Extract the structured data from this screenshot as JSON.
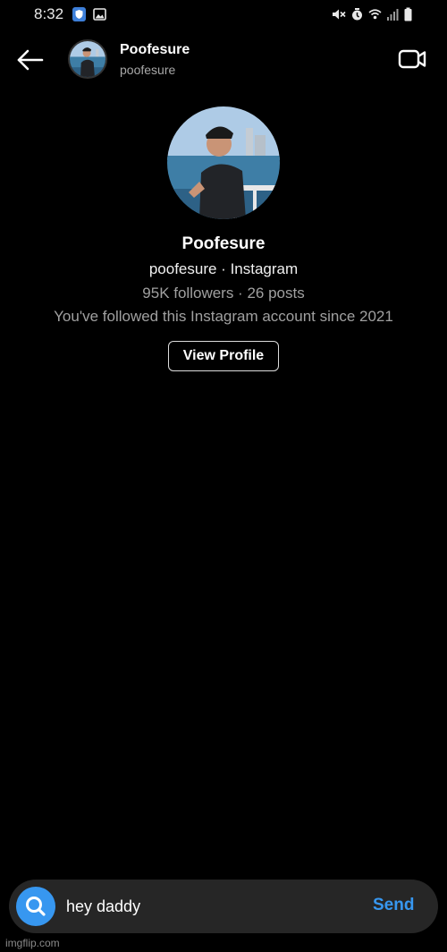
{
  "status_bar": {
    "time": "8:32",
    "left_icons": [
      "shield-icon",
      "gallery-icon"
    ],
    "right_icons": [
      "mute-icon",
      "alarm-icon",
      "wifi-icon",
      "signal-icon",
      "battery-icon"
    ]
  },
  "header": {
    "name": "Poofesure",
    "handle": "poofesure",
    "back_icon": "arrow-left-icon",
    "video_icon": "video-camera-icon"
  },
  "profile": {
    "name": "Poofesure",
    "subtitle": "poofesure · Instagram",
    "stats": "95K followers · 26 posts",
    "since": "You've followed this Instagram account since 2021",
    "view_profile_label": "View Profile"
  },
  "composer": {
    "message_value": "hey daddy",
    "send_label": "Send",
    "search_icon": "search-icon"
  },
  "watermark": "imgflip.com",
  "colors": {
    "background": "#000000",
    "accent": "#3797f0",
    "composer_bg": "#262626",
    "secondary_text": "#a0a0a0"
  }
}
